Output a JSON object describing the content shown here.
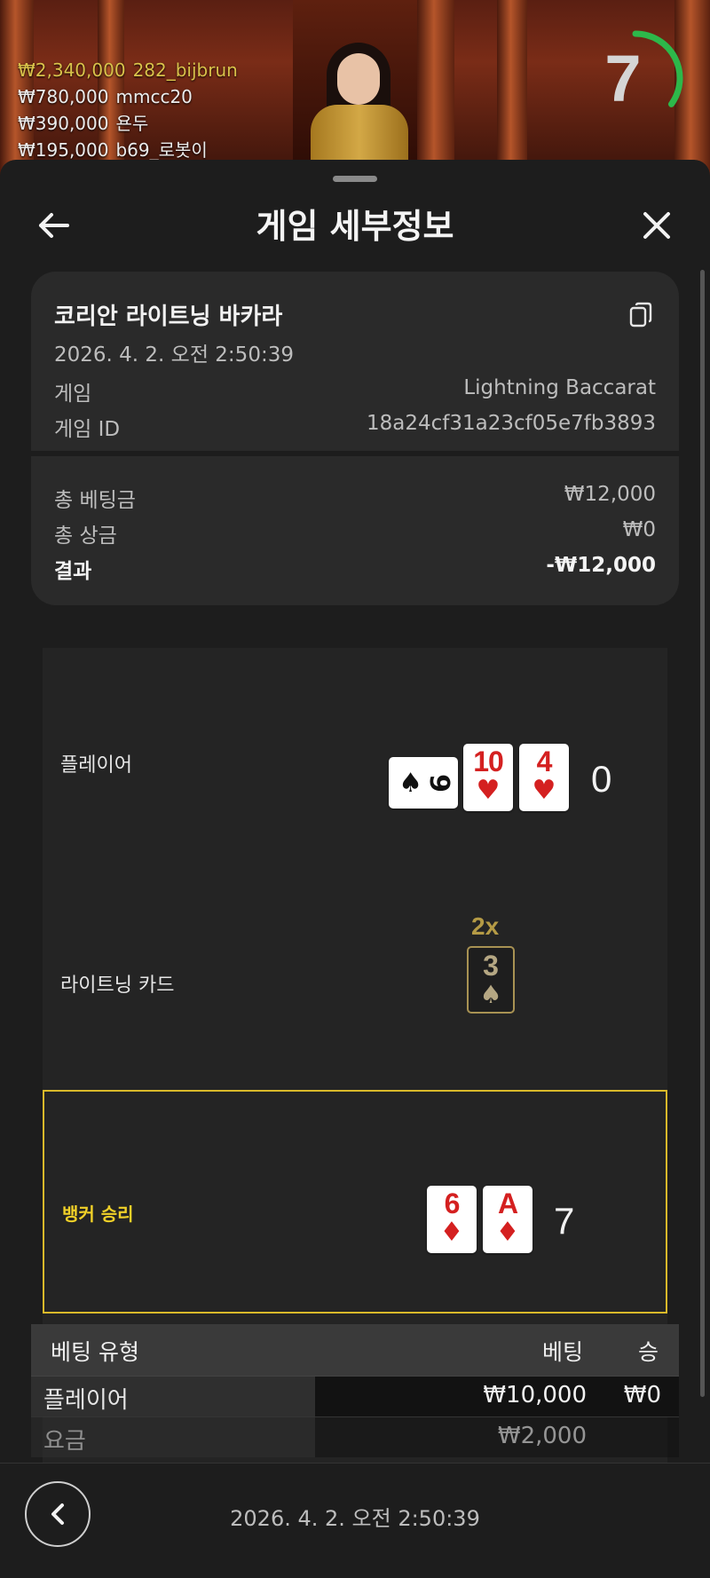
{
  "leaderboard": [
    {
      "amount": "₩2,340,000",
      "name": "282_bijbrun"
    },
    {
      "amount": "₩780,000",
      "name": "mmcc20"
    },
    {
      "amount": "₩390,000",
      "name": "욘두"
    },
    {
      "amount": "₩195,000",
      "name": "b69_로봇이"
    }
  ],
  "timer": {
    "value": "7",
    "fraction": 0.35,
    "color": "#2db84a"
  },
  "header": {
    "title": "게임 세부정보"
  },
  "game": {
    "name": "코리안 라이트닝 바카라",
    "datetime": "2026. 4. 2. 오전 2:50:39",
    "game_label": "게임",
    "game_value": "Lightning Baccarat",
    "id_label": "게임 ID",
    "id_value": "18a24cf31a23cf05e7fb3893"
  },
  "summary": {
    "total_bet_label": "총 베팅금",
    "total_bet_value": "₩12,000",
    "total_win_label": "총 상금",
    "total_win_value": "₩0",
    "result_label": "결과",
    "result_value": "-₩12,000"
  },
  "round": {
    "player": {
      "label": "플레이어",
      "score": "0",
      "cards": [
        {
          "rank": "9",
          "suit": "♠",
          "color": "black",
          "sideways": true
        },
        {
          "rank": "10",
          "suit": "♥",
          "color": "red"
        },
        {
          "rank": "4",
          "suit": "♥",
          "color": "red"
        }
      ]
    },
    "lightning": {
      "label": "라이트닝 카드",
      "multiplier": "2x",
      "card": {
        "rank": "3",
        "suit": "♠"
      }
    },
    "banker": {
      "label": "뱅커 승리",
      "score": "7",
      "cards": [
        {
          "rank": "6",
          "suit": "♦",
          "color": "red"
        },
        {
          "rank": "A",
          "suit": "♦",
          "color": "red"
        }
      ]
    }
  },
  "bets": {
    "columns": {
      "type": "베팅 유형",
      "bet": "베팅",
      "win": "승"
    },
    "rows": [
      {
        "type": "플레이어",
        "bet": "₩10,000",
        "win": "₩0"
      },
      {
        "type": "요금",
        "bet": "₩2,000",
        "win": ""
      }
    ]
  },
  "footer": {
    "datetime": "2026. 4. 2. 오전 2:50:39"
  },
  "colors": {
    "accent_gold": "#d9b92a",
    "timer_green": "#2db84a",
    "card_red": "#d42020"
  }
}
